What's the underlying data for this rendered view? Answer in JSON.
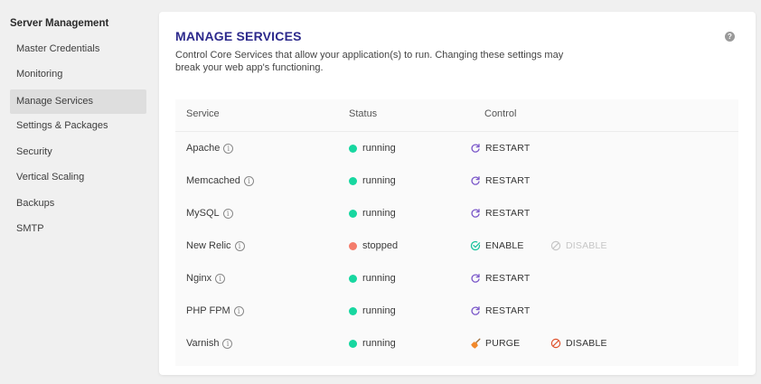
{
  "sidebar": {
    "title": "Server Management",
    "items": [
      {
        "label": "Master Credentials"
      },
      {
        "label": "Monitoring"
      },
      {
        "label": "Manage Services"
      },
      {
        "label": "Settings & Packages"
      },
      {
        "label": "Security"
      },
      {
        "label": "Vertical Scaling"
      },
      {
        "label": "Backups"
      },
      {
        "label": "SMTP"
      }
    ]
  },
  "card": {
    "title": "MANAGE SERVICES",
    "description": "Control Core Services that allow your application(s) to run. Changing these settings may break your web app's functioning.",
    "help_icon": "?"
  },
  "table": {
    "headers": {
      "service": "Service",
      "status": "Status",
      "control": "Control"
    },
    "rows": [
      {
        "service": "Apache",
        "status": "running",
        "actions": [
          {
            "label": "RESTART"
          }
        ]
      },
      {
        "service": "Memcached",
        "status": "running",
        "actions": [
          {
            "label": "RESTART"
          }
        ]
      },
      {
        "service": "MySQL",
        "status": "running",
        "actions": [
          {
            "label": "RESTART"
          }
        ]
      },
      {
        "service": "New Relic",
        "status": "stopped",
        "actions": [
          {
            "label": "ENABLE"
          },
          {
            "label": "DISABLE"
          }
        ]
      },
      {
        "service": "Nginx",
        "status": "running",
        "actions": [
          {
            "label": "RESTART"
          }
        ]
      },
      {
        "service": "PHP FPM",
        "status": "running",
        "actions": [
          {
            "label": "RESTART"
          }
        ]
      },
      {
        "service": "Varnish",
        "status": "running",
        "actions": [
          {
            "label": "PURGE"
          },
          {
            "label": "DISABLE"
          }
        ]
      }
    ]
  },
  "colors": {
    "accent": "#2d2a8c",
    "running": "#17d7a0",
    "stopped": "#f47c6b",
    "restart_icon": "#7b58c9",
    "enable_icon": "#17c39a",
    "disable_icon": "#e0532e",
    "disabled_text": "#c6c6c6"
  }
}
